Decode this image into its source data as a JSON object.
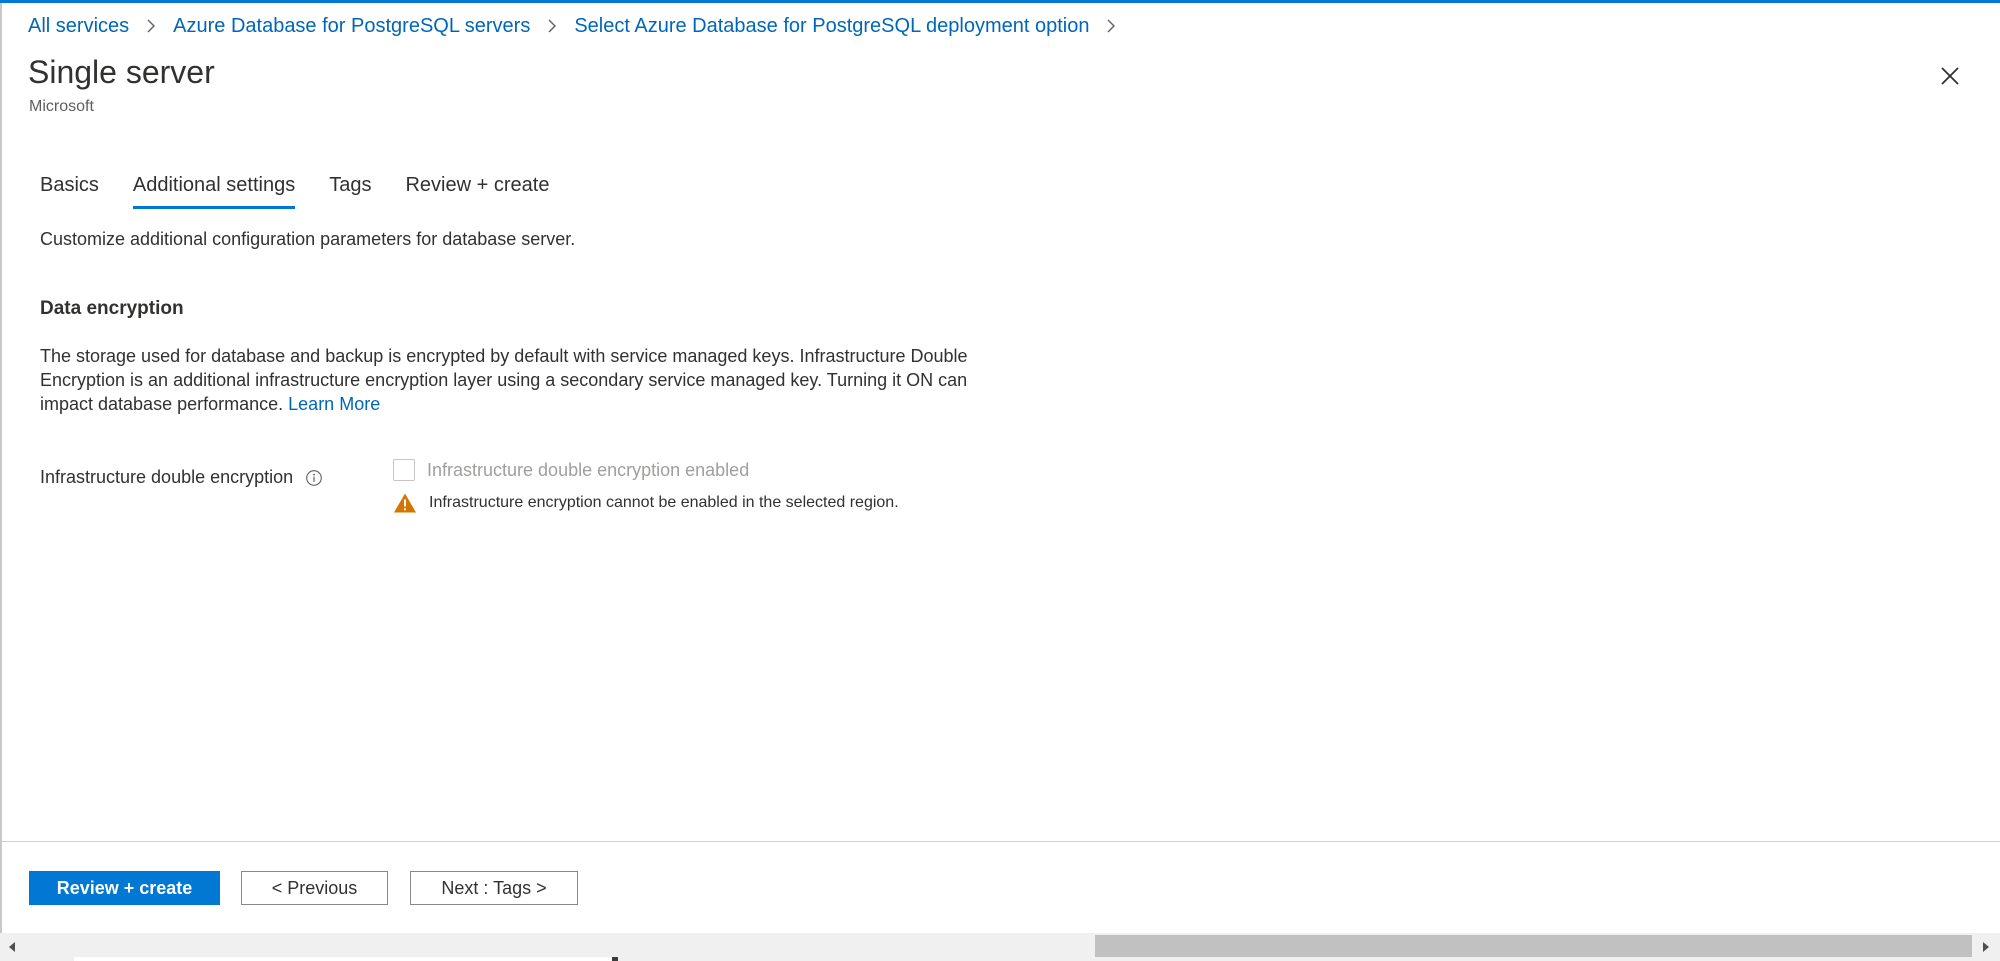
{
  "breadcrumb": [
    {
      "label": "All services"
    },
    {
      "label": "Azure Database for PostgreSQL servers"
    },
    {
      "label": "Select Azure Database for PostgreSQL deployment option"
    }
  ],
  "header": {
    "title": "Single server",
    "subtitle": "Microsoft"
  },
  "tabs": [
    {
      "label": "Basics",
      "active": false
    },
    {
      "label": "Additional settings",
      "active": true
    },
    {
      "label": "Tags",
      "active": false
    },
    {
      "label": "Review + create",
      "active": false
    }
  ],
  "main": {
    "description": "Customize additional configuration parameters for database server.",
    "section_title": "Data encryption",
    "section_text": "The storage used for database and backup is encrypted by default with service managed keys. Infrastructure Double Encryption is an additional infrastructure encryption layer using a secondary service managed key. Turning it ON can impact database performance.",
    "learn_more": "Learn More",
    "field_label": "Infrastructure double encryption",
    "checkbox_label": "Infrastructure double encryption enabled",
    "checkbox_checked": false,
    "checkbox_disabled": true,
    "warning_text": "Infrastructure encryption cannot be enabled in the selected region."
  },
  "footer": {
    "primary_label": "Review + create",
    "previous_label": "< Previous",
    "next_label": "Next : Tags >"
  },
  "icons": {
    "breadcrumb_separator": "chevron-right-icon",
    "close": "close-icon",
    "info": "info-icon",
    "warning": "warning-icon"
  },
  "colors": {
    "accent": "#0078d4",
    "link": "#0067b8",
    "warning": "#d47500",
    "disabled_text": "#a19f9d"
  }
}
